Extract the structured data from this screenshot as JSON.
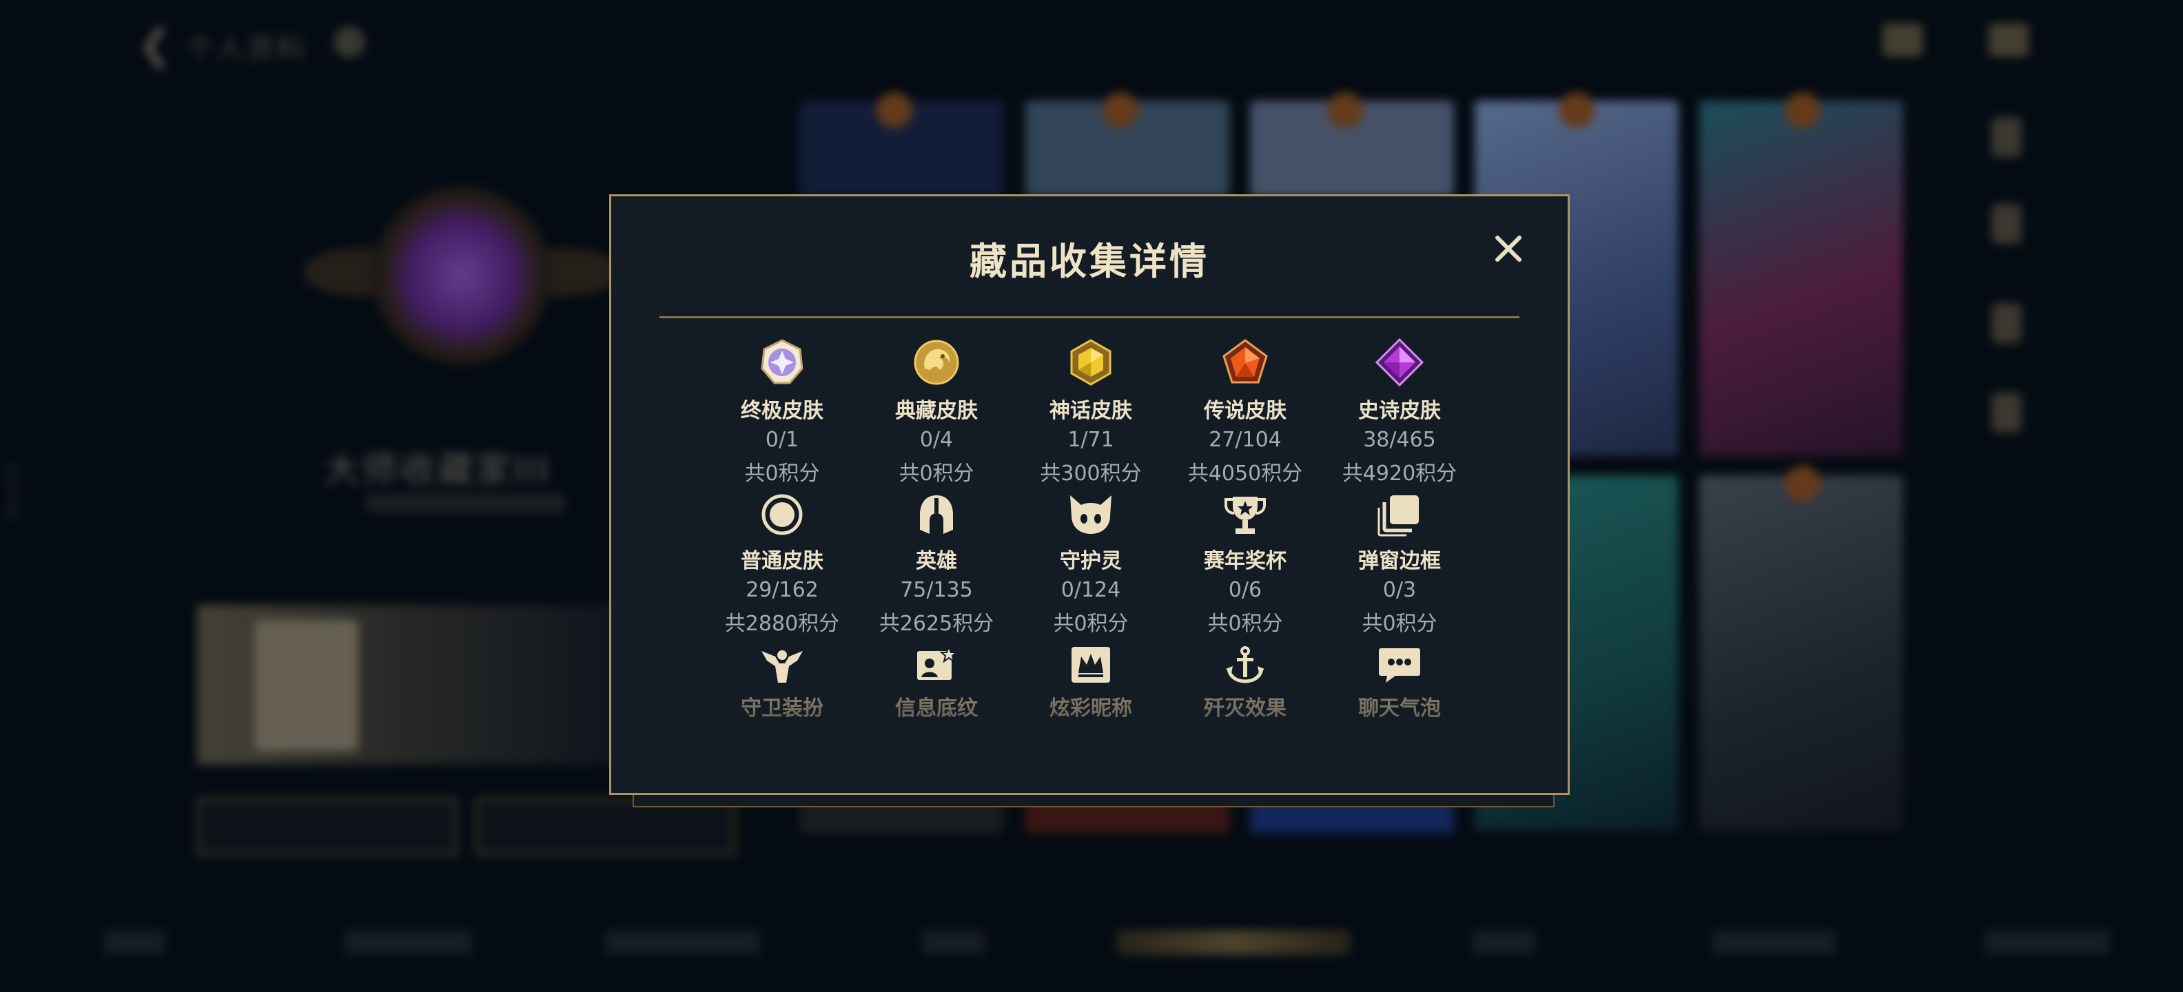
{
  "app": {
    "back_label": "❮",
    "page_title": "个人资料",
    "player_name": "大师收藏家III",
    "side_id": "225746"
  },
  "modal": {
    "title": "藏品收集详情",
    "close_label": "✕",
    "rows": [
      [
        {
          "icon": "ultimate-skin-gem-icon",
          "label": "终极皮肤",
          "count": "0/1",
          "points": "共0积分"
        },
        {
          "icon": "prestige-dragon-icon",
          "label": "典藏皮肤",
          "count": "0/4",
          "points": "共0积分"
        },
        {
          "icon": "mythic-gem-icon",
          "label": "神话皮肤",
          "count": "1/71",
          "points": "共300积分"
        },
        {
          "icon": "legendary-gem-icon",
          "label": "传说皮肤",
          "count": "27/104",
          "points": "共4050积分"
        },
        {
          "icon": "epic-gem-icon",
          "label": "史诗皮肤",
          "count": "38/465",
          "points": "共4920积分"
        }
      ],
      [
        {
          "icon": "standard-skin-ring-icon",
          "label": "普通皮肤",
          "count": "29/162",
          "points": "共2880积分"
        },
        {
          "icon": "champion-helmet-icon",
          "label": "英雄",
          "count": "75/135",
          "points": "共2625积分"
        },
        {
          "icon": "little-legend-icon",
          "label": "守护灵",
          "count": "0/124",
          "points": "共0积分"
        },
        {
          "icon": "season-trophy-icon",
          "label": "赛年奖杯",
          "count": "0/6",
          "points": "共0积分"
        },
        {
          "icon": "popup-border-icon",
          "label": "弹窗边框",
          "count": "0/3",
          "points": "共0积分"
        }
      ],
      [
        {
          "icon": "ward-skin-icon",
          "label": "守卫装扮"
        },
        {
          "icon": "banner-pattern-icon",
          "label": "信息底纹"
        },
        {
          "icon": "colorful-nickname-icon",
          "label": "炫彩昵称"
        },
        {
          "icon": "elimination-effect-icon",
          "label": "歼灭效果"
        },
        {
          "icon": "chat-bubble-icon",
          "label": "聊天气泡"
        }
      ]
    ]
  },
  "colors": {
    "gold": "#d8bf82",
    "modal_bg": "#131c25",
    "modal_border": "#ad9561",
    "label": "#ece2c8",
    "muted": "#a4aab0"
  }
}
